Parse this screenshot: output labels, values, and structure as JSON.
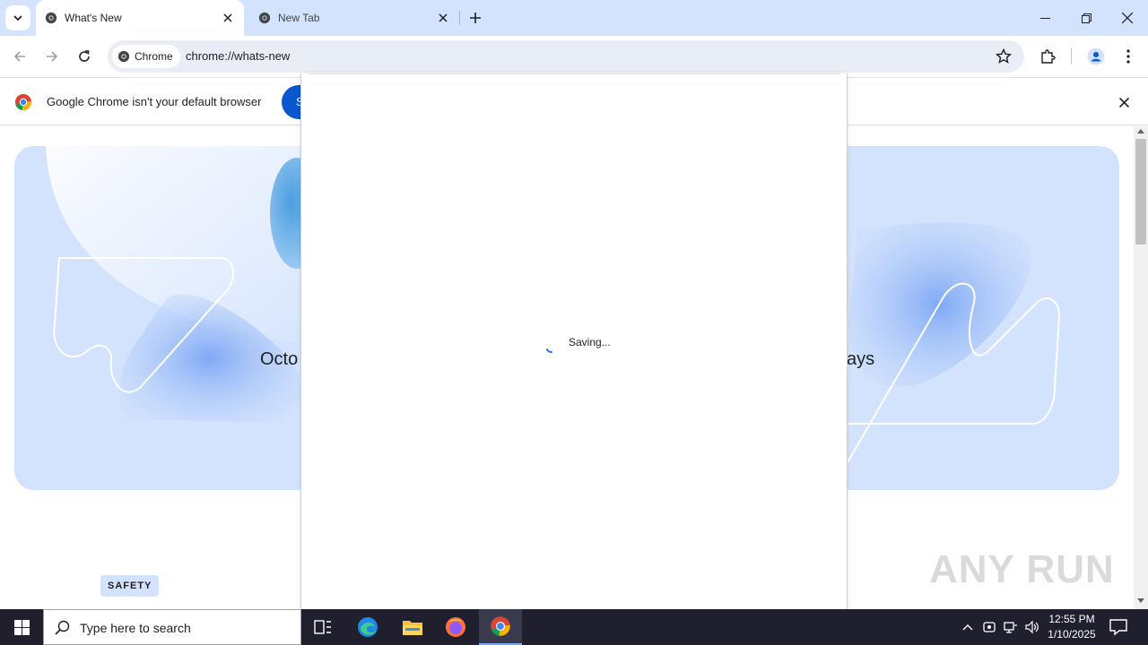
{
  "tabs": [
    {
      "title": "What's New",
      "active": true
    },
    {
      "title": "New Tab",
      "active": false
    }
  ],
  "toolbar": {
    "site_chip": "Chrome",
    "url": "chrome://whats-new"
  },
  "infobar": {
    "message": "Google Chrome isn't your default browser",
    "button_label": "S"
  },
  "hero": {
    "left_text": "Octo",
    "right_text": "ays"
  },
  "page": {
    "badge": "SAFETY",
    "watermark": "ANY RUN"
  },
  "dialog": {
    "status": "Saving..."
  },
  "taskbar": {
    "search_placeholder": "Type here to search",
    "time": "12:55 PM",
    "date": "1/10/2025"
  },
  "colors": {
    "tabstrip": "#d3e3fd",
    "hero_bg": "#d3e3fd",
    "accent": "#0b57d0",
    "taskbar": "#1f1f2e"
  }
}
